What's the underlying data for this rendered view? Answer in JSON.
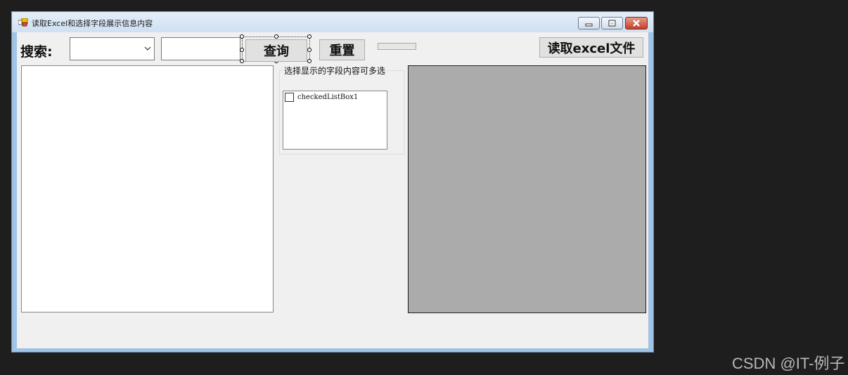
{
  "window": {
    "title": "读取Excel和选择字段展示信息内容",
    "icon": "app-icon",
    "controls": [
      "minimize-icon",
      "maximize-icon",
      "close-icon"
    ]
  },
  "toolbar": {
    "search_label": "搜索:",
    "combo_value": "",
    "search_text": "",
    "query_label": "查询",
    "reset_label": "重置",
    "read_excel_label": "读取excel文件"
  },
  "field_group": {
    "label": "选择显示的字段内容可多选",
    "items": [
      {
        "label": "checkedListBox1",
        "checked": false
      }
    ]
  },
  "watermark": "CSDN @IT-例子",
  "colors": {
    "window_client": "#f0f0f0",
    "display_panel": "#ababab",
    "close_button": "#c2402a"
  }
}
